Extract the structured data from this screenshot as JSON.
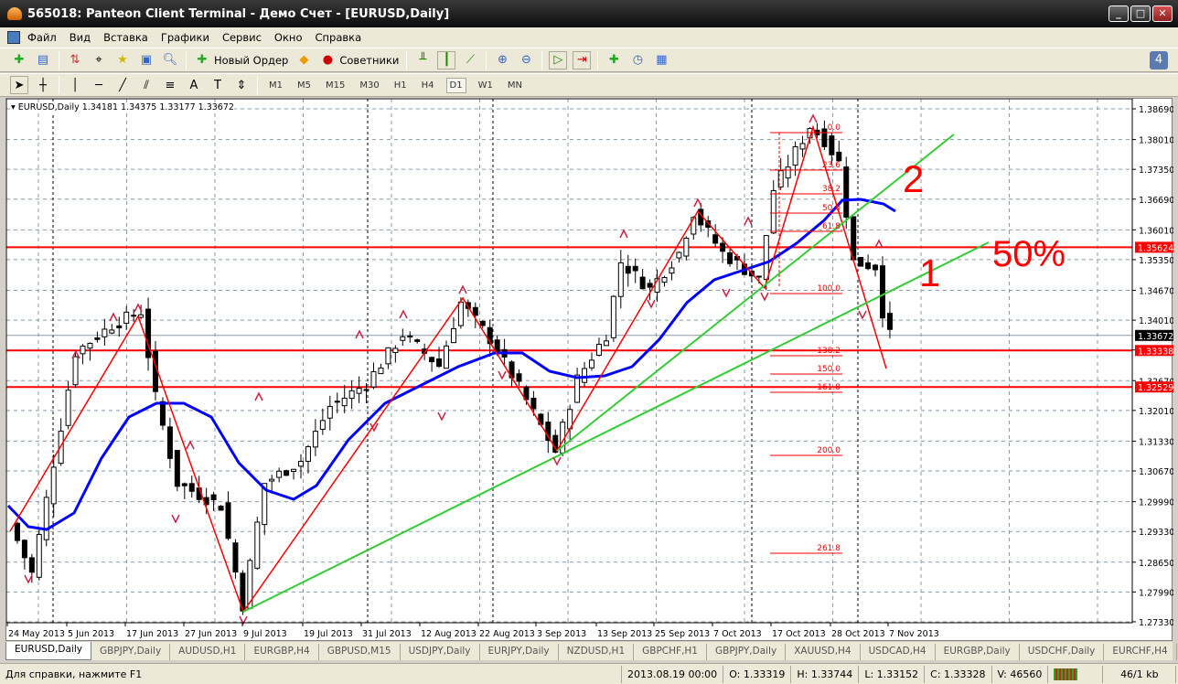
{
  "window": {
    "title": "565018: Panteon Client Terminal - Демо Счет - [EURUSD,Daily]"
  },
  "menu": [
    "Файл",
    "Вид",
    "Вставка",
    "Графики",
    "Сервис",
    "Окно",
    "Справка"
  ],
  "toolbar": {
    "new_order": "Новый Ордер",
    "experts": "Советники"
  },
  "timeframes": [
    "M1",
    "M5",
    "M15",
    "M30",
    "H1",
    "H4",
    "D1",
    "W1",
    "MN"
  ],
  "active_timeframe": "D1",
  "chart": {
    "info": "EURUSD,Daily  1.34181 1.34375 1.33177 1.33672",
    "price_ticks": [
      "1.38690",
      "1.38010",
      "1.37350",
      "1.36690",
      "1.36010",
      "1.35350",
      "1.34670",
      "1.34010",
      "1.33350",
      "1.32670",
      "1.32010",
      "1.31330",
      "1.30670",
      "1.29990",
      "1.29330",
      "1.28650",
      "1.27990",
      "1.27330"
    ],
    "current_price": "1.33672",
    "levels": [
      "1.35624",
      "1.33338",
      "1.32529"
    ],
    "date_labels": [
      "24 May 2013",
      "5 Jun 2013",
      "17 Jun 2013",
      "27 Jun 2013",
      "9 Jul 2013",
      "19 Jul 2013",
      "31 Jul 2013",
      "12 Aug 2013",
      "22 Aug 2013",
      "3 Sep 2013",
      "13 Sep 2013",
      "25 Sep 2013",
      "7 Oct 2013",
      "17 Oct 2013",
      "28 Oct 2013",
      "7 Nov 2013"
    ],
    "fib_levels": [
      "0.0",
      "23.6",
      "38.2",
      "50.0",
      "61.8",
      "100.0",
      "138.2",
      "150.0",
      "161.8",
      "200.0",
      "261.8"
    ],
    "annotations": {
      "a2": "2",
      "a1": "1",
      "a50": "50%"
    },
    "pivots": [
      [
        0,
        1.295
      ],
      [
        3,
        1.284
      ],
      [
        9,
        1.333
      ],
      [
        14,
        1.339
      ],
      [
        18,
        1.342
      ],
      [
        20,
        1.323
      ],
      [
        23,
        1.304
      ],
      [
        29,
        1.299
      ],
      [
        32,
        1.277
      ],
      [
        35,
        1.304
      ],
      [
        40,
        1.309
      ],
      [
        44,
        1.321
      ],
      [
        49,
        1.326
      ],
      [
        54,
        1.337
      ],
      [
        59,
        1.33
      ],
      [
        62,
        1.344
      ],
      [
        66,
        1.336
      ],
      [
        69,
        1.328
      ],
      [
        75,
        1.311
      ],
      [
        78,
        1.327
      ],
      [
        82,
        1.337
      ],
      [
        84,
        1.353
      ],
      [
        88,
        1.347
      ],
      [
        92,
        1.355
      ],
      [
        94,
        1.364
      ],
      [
        98,
        1.355
      ],
      [
        103,
        1.349
      ],
      [
        105,
        1.369
      ],
      [
        110,
        1.383
      ],
      [
        112,
        1.38
      ],
      [
        114,
        1.375
      ],
      [
        116,
        1.353
      ],
      [
        119,
        1.352
      ],
      [
        120,
        1.342
      ],
      [
        121,
        1.3367
      ]
    ],
    "colors": {
      "bull": "#ffffff",
      "bear": "#000000",
      "ma": "#0000ff",
      "zigzag": "#ff0000",
      "trend": "#33cc33",
      "level": "#ff0000"
    }
  },
  "tabs": [
    "EURUSD,Daily",
    "GBPJPY,Daily",
    "AUDUSD,H1",
    "EURGBP,H4",
    "GBPUSD,M15",
    "USDJPY,Daily",
    "EURJPY,Daily",
    "NZDUSD,H1",
    "GBPCHF,H1",
    "GBPJPY,Daily",
    "XAUUSD,H4",
    "USDCAD,H4",
    "EURGBP,Daily",
    "USDCHF,Daily",
    "EURCHF,H4"
  ],
  "status": {
    "help": "Для справки, нажмите F1",
    "datetime": "2013.08.19 00:00",
    "open": "O: 1.33319",
    "high": "H: 1.33744",
    "low": "L: 1.33152",
    "close": "C: 1.33328",
    "volume": "V: 46560",
    "traffic": "46/1 kb"
  }
}
